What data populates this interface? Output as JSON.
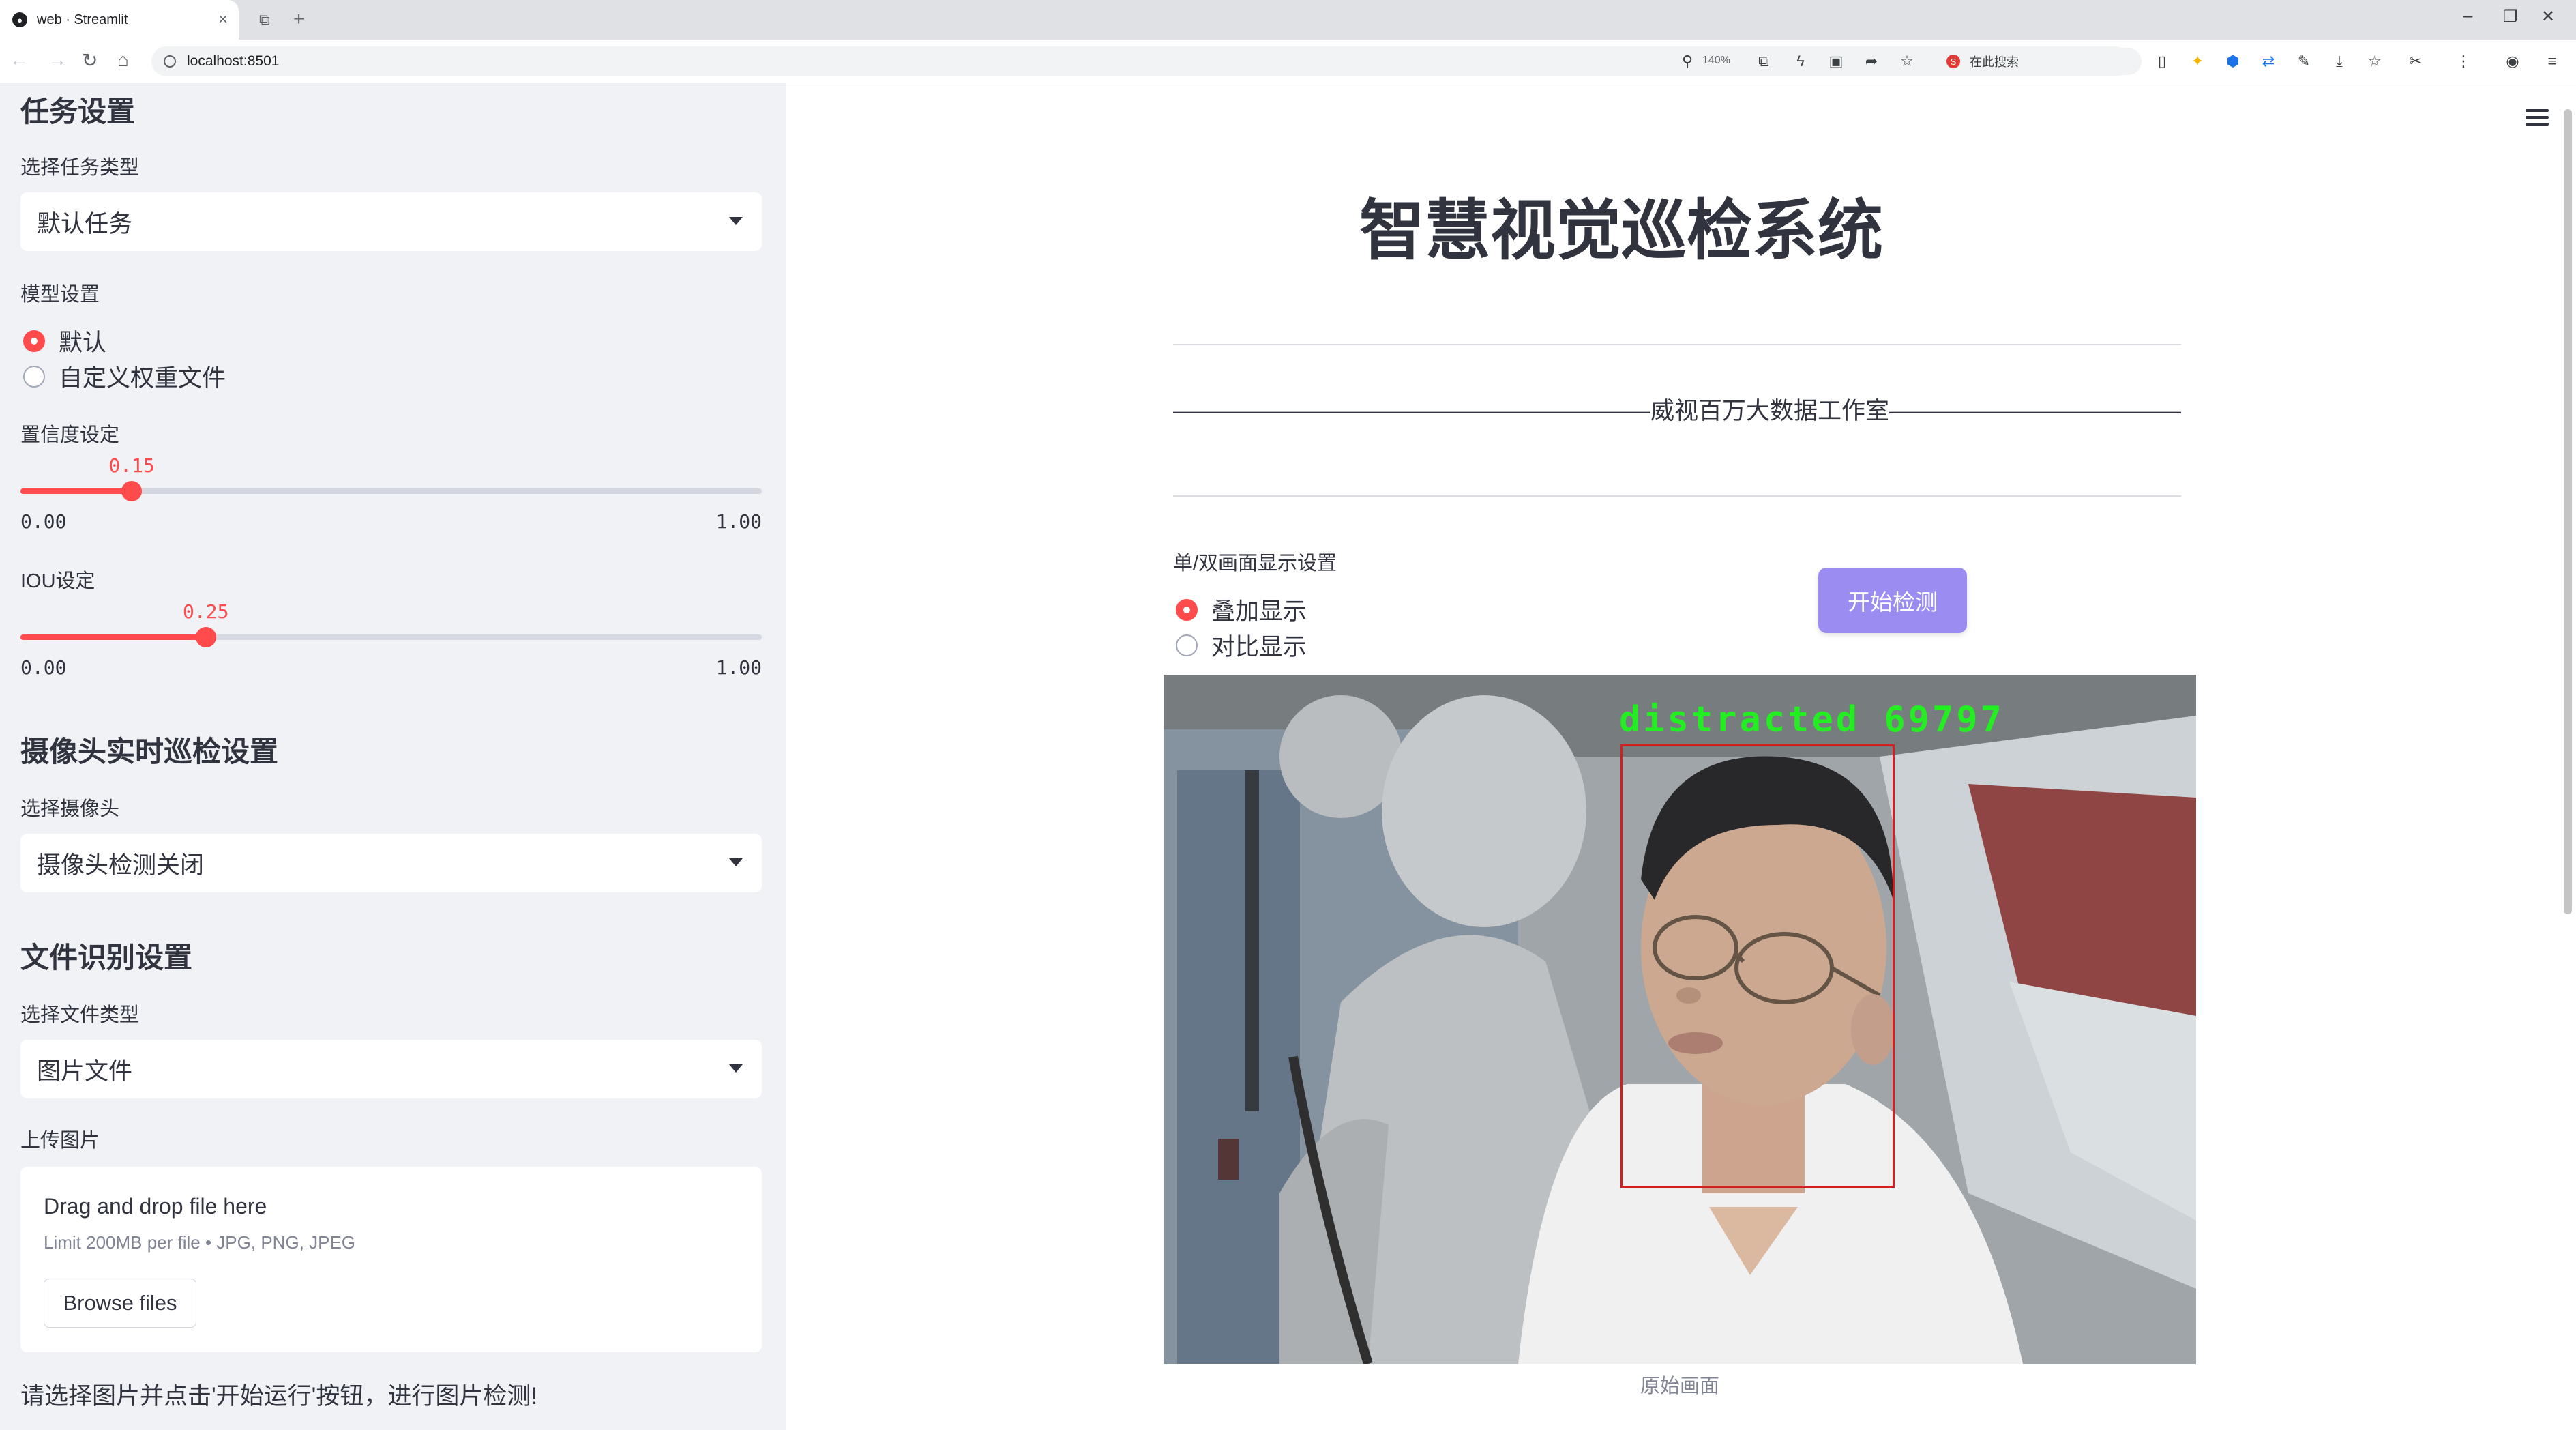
{
  "browser": {
    "tab_title": "web · Streamlit",
    "tab_favicon": "streamlit-icon",
    "url": "localhost:8501",
    "zoom": "140%",
    "search_box": "在此搜索"
  },
  "sidebar": {
    "task_section": {
      "heading": "任务设置",
      "select_label": "选择任务类型",
      "select_value": "默认任务"
    },
    "model_section": {
      "label": "模型设置",
      "options": [
        "默认",
        "自定义权重文件"
      ],
      "selected": 0
    },
    "confidence": {
      "label": "置信度设定",
      "value": "0.15",
      "min": "0.00",
      "max": "1.00",
      "fraction": 0.15
    },
    "iou": {
      "label": "IOU设定",
      "value": "0.25",
      "min": "0.00",
      "max": "1.00",
      "fraction": 0.25
    },
    "camera_section": {
      "heading": "摄像头实时巡检设置",
      "select_label": "选择摄像头",
      "select_value": "摄像头检测关闭"
    },
    "file_section": {
      "heading": "文件识别设置",
      "select_label": "选择文件类型",
      "select_value": "图片文件",
      "upload_label": "上传图片",
      "drop_title": "Drag and drop file here",
      "drop_limit": "Limit 200MB per file • JPG, PNG, JPEG",
      "browse_button": "Browse files"
    },
    "hint": "请选择图片并点击'开始运行'按钮，进行图片检测!"
  },
  "main": {
    "title": "智慧视觉巡检系统",
    "studio_line": "————————————————————威视百万大数据工作室—————————————————————",
    "display_setting_label": "单/双画面显示设置",
    "display_options": [
      "叠加显示",
      "对比显示"
    ],
    "display_selected": 0,
    "start_button": "开始检测",
    "detection_label": "distracted 69797",
    "image_caption": "原始画面"
  },
  "colors": {
    "accent": "#ff4b4b",
    "sidebar_bg": "#f0f2f6",
    "button": "#9a8cf0",
    "detection_text": "#22ee22",
    "detection_box": "#d02020"
  }
}
